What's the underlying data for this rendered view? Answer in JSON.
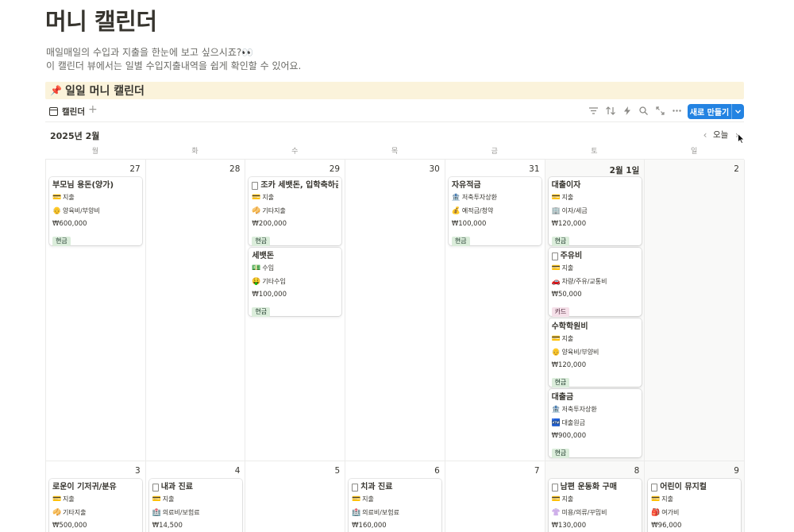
{
  "page": {
    "title": "머니 캘린더",
    "description_line1": "매일매일의 수입과 지출을 한눈에 보고 싶으시죠?👀",
    "description_line2": "이 캘린더 뷰에서는 일별 수입지출내역을 쉽게 확인할 수 있어요."
  },
  "callout": {
    "icon": "📌",
    "text": "일일 머니 캘린더"
  },
  "toolbar": {
    "view_tab_label": "캘린더",
    "add_view": "+",
    "icons": [
      "filter-icon",
      "sort-icon",
      "automation-icon",
      "search-icon",
      "expand-icon",
      "more-icon"
    ],
    "new_button_label": "새로 만들기",
    "new_button_caret": "⌄",
    "accent_color": "#2383e2"
  },
  "calendar": {
    "month_label": "2025년 2월",
    "today_label": "오늘",
    "prev_arrow": "‹",
    "next_arrow": "›",
    "weekdays": [
      "월",
      "화",
      "수",
      "목",
      "금",
      "토",
      "일"
    ],
    "tag_colors": {
      "현금": "#dbeddb",
      "카드": "#f5e0e9"
    },
    "week1": {
      "days": [
        "27",
        "28",
        "29",
        "30",
        "31",
        "2월 1일",
        "2"
      ],
      "cards": [
        {
          "day": 0,
          "title": "부모님 용돈(양가)",
          "doc_icon": false,
          "type_emoji": "💳",
          "type": "지출",
          "category_emoji": "👴",
          "category": "양육비/부양비",
          "amount": "₩600,000",
          "payment": "현금"
        },
        {
          "day": 2,
          "title": "조카 세뱃돈, 입학축하금",
          "doc_icon": true,
          "type_emoji": "💳",
          "type": "지출",
          "category_emoji": "🥠",
          "category": "기타지출",
          "amount": "₩200,000",
          "payment": "현금"
        },
        {
          "day": 2,
          "title": "세뱃돈",
          "doc_icon": false,
          "type_emoji": "💵",
          "type": "수입",
          "category_emoji": "🤑",
          "category": "기타수입",
          "amount": "₩100,000",
          "payment": "현금"
        },
        {
          "day": 4,
          "title": "자유적금",
          "doc_icon": false,
          "type_emoji": "🏦",
          "type": "저축투자상환",
          "category_emoji": "💰",
          "category": "예적금/청약",
          "amount": "₩100,000",
          "payment": "현금"
        },
        {
          "day": 5,
          "title": "대출이자",
          "doc_icon": false,
          "type_emoji": "💳",
          "type": "지출",
          "category_emoji": "🏢",
          "category": "이자/세금",
          "amount": "₩120,000",
          "payment": "현금"
        },
        {
          "day": 5,
          "title": "주유비",
          "doc_icon": true,
          "type_emoji": "💳",
          "type": "지출",
          "category_emoji": "🚗",
          "category": "차량/주유/교통비",
          "amount": "₩50,000",
          "payment": "카드"
        },
        {
          "day": 5,
          "title": "수학학원비",
          "doc_icon": false,
          "type_emoji": "💳",
          "type": "지출",
          "category_emoji": "👴",
          "category": "양육비/부양비",
          "amount": "₩120,000",
          "payment": "현금"
        },
        {
          "day": 5,
          "title": "대출금",
          "doc_icon": false,
          "type_emoji": "🏦",
          "type": "저축투자상환",
          "category_emoji": "🏧",
          "category": "대출원금",
          "amount": "₩900,000",
          "payment": "현금"
        }
      ]
    },
    "week2": {
      "days": [
        "3",
        "4",
        "5",
        "6",
        "7",
        "8",
        "9"
      ],
      "cards": [
        {
          "day": 0,
          "title": "로운이 기저귀/분유",
          "doc_icon": false,
          "type_emoji": "💳",
          "type": "지출",
          "category_emoji": "🥠",
          "category": "기타지출",
          "amount": "₩500,000"
        },
        {
          "day": 1,
          "title": "내과 진료",
          "doc_icon": true,
          "type_emoji": "💳",
          "type": "지출",
          "category_emoji": "🏥",
          "category": "의료비/보험료",
          "amount": "₩14,500"
        },
        {
          "day": 3,
          "title": "치과 진료",
          "doc_icon": true,
          "type_emoji": "💳",
          "type": "지출",
          "category_emoji": "🏥",
          "category": "의료비/보험료",
          "amount": "₩160,000"
        },
        {
          "day": 5,
          "title": "남편 운동화 구매",
          "doc_icon": true,
          "type_emoji": "💳",
          "type": "지출",
          "category_emoji": "👚",
          "category": "미용/의류/꾸밈비",
          "amount": "₩130,000"
        },
        {
          "day": 6,
          "title": "어린이 뮤지컬",
          "doc_icon": true,
          "type_emoji": "💳",
          "type": "지출",
          "category_emoji": "🎒",
          "category": "여가비",
          "amount": "₩96,000"
        }
      ]
    }
  }
}
